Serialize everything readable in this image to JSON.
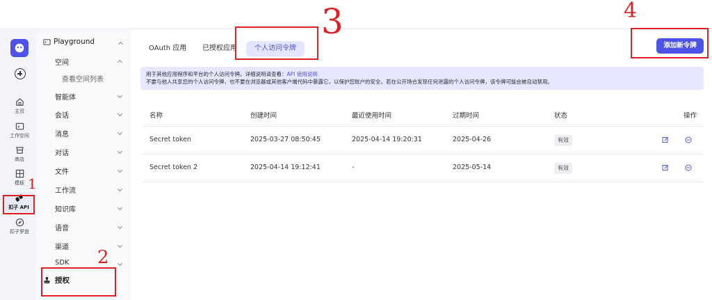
{
  "rail": {
    "items": [
      {
        "label": "主页",
        "icon": "home-icon"
      },
      {
        "label": "工作空间",
        "icon": "workspace-icon"
      },
      {
        "label": "商店",
        "icon": "store-icon"
      },
      {
        "label": "模板",
        "icon": "template-icon"
      },
      {
        "label": "扣子 API",
        "icon": "api-icon"
      },
      {
        "label": "扣子罗盘",
        "icon": "compass-icon"
      }
    ]
  },
  "nav": {
    "header": "Playground",
    "items": [
      {
        "label": "空间"
      },
      {
        "label": "查看空间列表"
      },
      {
        "label": "智能体"
      },
      {
        "label": "会话"
      },
      {
        "label": "消息"
      },
      {
        "label": "对话"
      },
      {
        "label": "文件"
      },
      {
        "label": "工作流"
      },
      {
        "label": "知识库"
      },
      {
        "label": "语音"
      },
      {
        "label": "渠道"
      },
      {
        "label": "SDK"
      }
    ],
    "auth_label": "授权"
  },
  "tabs": [
    "OAuth 应用",
    "已授权应用",
    "个人访问令牌"
  ],
  "new_token_button": "添加新令牌",
  "notice": {
    "line1_prefix": "用于其他应用程序和平台的个人访问令牌。详细说明请查看：",
    "line1_link": "API 使用说明",
    "line2": "不要与他人共享您的个人访问令牌，也不要在浏览器或其他客户端代码中暴露它，以保护您账户的安全。若在公开场合发现任何泄露的个人访问令牌，该令牌可能会被自动禁用。"
  },
  "table": {
    "columns": [
      "名称",
      "创建时间",
      "最近使用时间",
      "过期时间",
      "状态",
      "操作"
    ],
    "rows": [
      {
        "name": "Secret token",
        "created": "2025-03-27 08:50:45",
        "last_used": "2025-04-14 19:20:31",
        "expires": "2025-04-26",
        "status": "有效"
      },
      {
        "name": "Secret token 2",
        "created": "2025-04-14 19:12:41",
        "last_used": "-",
        "expires": "2025-05-14",
        "status": "有效"
      }
    ]
  },
  "annotations": [
    "1",
    "2",
    "3",
    "4"
  ],
  "colors": {
    "accent": "#4d53e8",
    "annotation": "#e02020",
    "notice_bg": "#e6e8ff"
  }
}
